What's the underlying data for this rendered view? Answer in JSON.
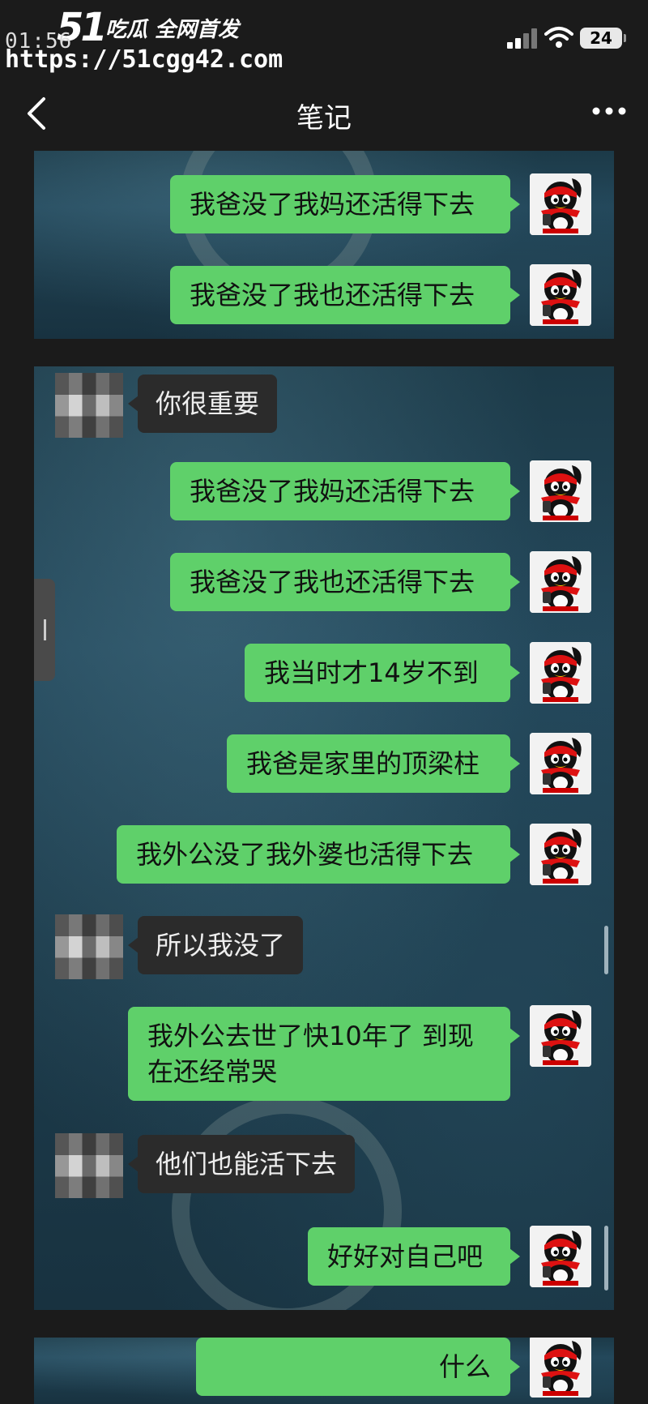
{
  "watermark": {
    "logo": "51",
    "slogan": "吃瓜 全网首发",
    "time": "01:56",
    "url": "https://51cgg42.com"
  },
  "status_bar": {
    "battery": "24"
  },
  "nav": {
    "title": "笔记",
    "back_icon": "chevron-left-icon",
    "more_icon": "more-dots-icon"
  },
  "panel1": {
    "messages": [
      {
        "side": "right",
        "text": "我爸没了我妈还活得下去"
      },
      {
        "side": "right",
        "text": "我爸没了我也还活得下去"
      }
    ]
  },
  "panel2": {
    "messages": [
      {
        "side": "left",
        "text": "你很重要"
      },
      {
        "side": "right",
        "text": "我爸没了我妈还活得下去"
      },
      {
        "side": "right",
        "text": "我爸没了我也还活得下去"
      },
      {
        "side": "right",
        "text": "我当时才14岁不到"
      },
      {
        "side": "right",
        "text": "我爸是家里的顶梁柱"
      },
      {
        "side": "right",
        "text": "我外公没了我外婆也活得下去"
      },
      {
        "side": "left",
        "text": "所以我没了"
      },
      {
        "side": "right",
        "text": "我外公去世了快10年了 到现在还经常哭"
      },
      {
        "side": "left",
        "text": "他们也能活下去"
      },
      {
        "side": "right",
        "text": "好好对自己吧"
      }
    ]
  },
  "panel3": {
    "messages": [
      {
        "side": "right",
        "text": "什么"
      }
    ]
  },
  "colors": {
    "bubble_green": "#5fd06a",
    "bubble_dark": "#2b2b2b",
    "page_bg": "#1b1b1b"
  }
}
